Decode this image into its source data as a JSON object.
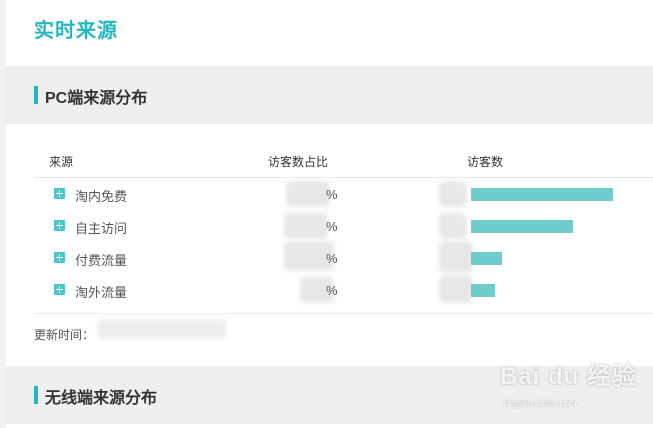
{
  "page": {
    "title": "实时来源"
  },
  "pc_section": {
    "title": "PC端来源分布",
    "columns": [
      "来源",
      "访客数占比",
      "访客数"
    ],
    "rows": [
      {
        "label": "淘内免费",
        "pct_suffix": "%",
        "visitor_share": 0.78
      },
      {
        "label": "自主访问",
        "pct_suffix": "%",
        "visitor_share": 0.56
      },
      {
        "label": "付费流量",
        "pct_suffix": "%",
        "visitor_share": 0.17
      },
      {
        "label": "淘外流量",
        "pct_suffix": "%",
        "visitor_share": 0.13
      }
    ],
    "update_label": "更新时间："
  },
  "mobile_section": {
    "title": "无线端来源分布"
  },
  "watermark": {
    "brand": "Bai du 经验",
    "url": "jingyan.baidu.com"
  },
  "colors": {
    "accent": "#23b7bf",
    "bar": "#6ecdcc"
  }
}
